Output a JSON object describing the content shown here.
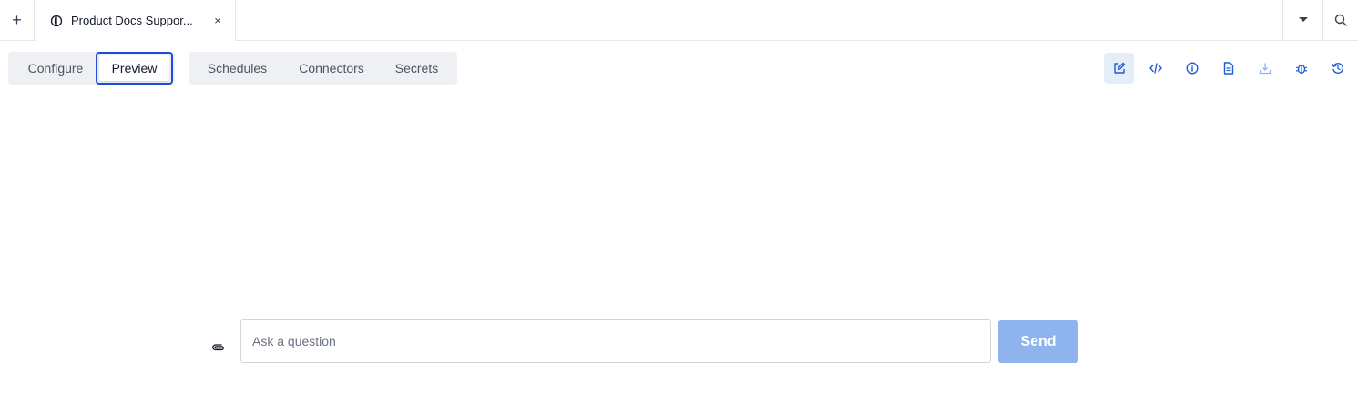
{
  "tabbar": {
    "tabs": [
      {
        "label": "Product Docs Suppor...",
        "icon": "agent-icon",
        "close": "×"
      }
    ],
    "new_tab_label": "+",
    "dropdown_icon": "caret-down-icon",
    "search_icon": "search-icon"
  },
  "toolbar": {
    "mode_tabs": [
      {
        "label": "Configure",
        "selected": false
      },
      {
        "label": "Preview",
        "selected": true
      }
    ],
    "section_tabs": [
      {
        "label": "Schedules"
      },
      {
        "label": "Connectors"
      },
      {
        "label": "Secrets"
      }
    ],
    "actions": [
      {
        "icon": "edit-icon",
        "active": true
      },
      {
        "icon": "code-icon",
        "active": false
      },
      {
        "icon": "info-icon",
        "active": false
      },
      {
        "icon": "document-icon",
        "active": false
      },
      {
        "icon": "download-icon",
        "active": false
      },
      {
        "icon": "bug-icon",
        "active": false
      },
      {
        "icon": "history-icon",
        "active": false
      }
    ]
  },
  "chat": {
    "attach_icon": "paperclip-icon",
    "input_value": "",
    "input_placeholder": "Ask a question",
    "send_label": "Send"
  },
  "colors": {
    "accent": "#1d4ed8",
    "icon_blue": "#1e5bd6",
    "send_disabled": "#8fb3ec",
    "segment_bg": "#eef0f3",
    "active_icon_bg": "#e5edf9"
  }
}
